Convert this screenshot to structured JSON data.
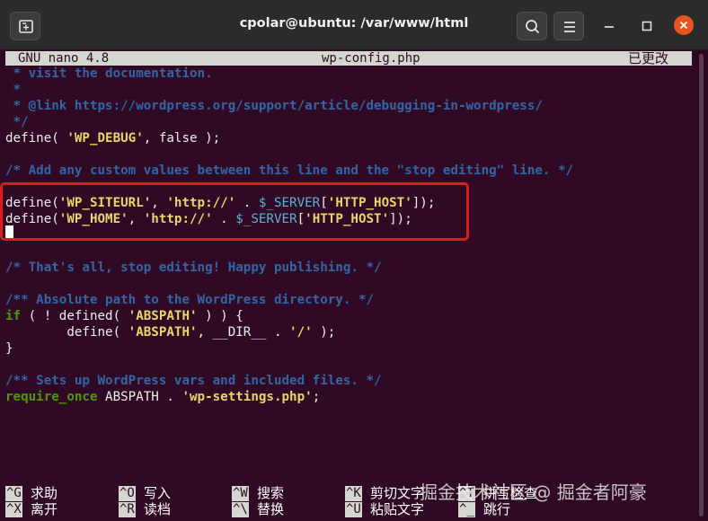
{
  "window": {
    "title": "cpolar@ubuntu: /var/www/html"
  },
  "nano": {
    "version": "GNU nano 4.8",
    "filename": "wp-config.php",
    "status": "已更改"
  },
  "code": [
    [
      {
        "t": " * visit the documentation.",
        "c": "comment"
      }
    ],
    [
      {
        "t": " *",
        "c": "comment"
      }
    ],
    [
      {
        "t": " * @link https://wordpress.org/support/article/debugging-in-wordpress/",
        "c": "comment"
      }
    ],
    [
      {
        "t": " */",
        "c": "comment"
      }
    ],
    [
      {
        "t": "define( ",
        "c": "fn"
      },
      {
        "t": "'WP_DEBUG'",
        "c": "str"
      },
      {
        "t": ", false );",
        "c": "fn"
      }
    ],
    [],
    [
      {
        "t": "/* Add any custom values between this line and the \"stop editing\" line. */",
        "c": "comment"
      }
    ],
    [],
    [
      {
        "t": "define(",
        "c": "fn"
      },
      {
        "t": "'WP_SITEURL'",
        "c": "str"
      },
      {
        "t": ", ",
        "c": "fn"
      },
      {
        "t": "'http://'",
        "c": "str"
      },
      {
        "t": " . ",
        "c": "fn"
      },
      {
        "t": "$_SERVER",
        "c": "var"
      },
      {
        "t": "[",
        "c": "fn"
      },
      {
        "t": "'HTTP_HOST'",
        "c": "str"
      },
      {
        "t": "]);",
        "c": "fn"
      }
    ],
    [
      {
        "t": "define(",
        "c": "fn"
      },
      {
        "t": "'WP_HOME'",
        "c": "str"
      },
      {
        "t": ", ",
        "c": "fn"
      },
      {
        "t": "'http://'",
        "c": "str"
      },
      {
        "t": " . ",
        "c": "fn"
      },
      {
        "t": "$_SERVER",
        "c": "var"
      },
      {
        "t": "[",
        "c": "fn"
      },
      {
        "t": "'HTTP_HOST'",
        "c": "str"
      },
      {
        "t": "]);",
        "c": "fn"
      }
    ],
    [],
    [],
    [
      {
        "t": "/* That's all, stop editing! Happy publishing. */",
        "c": "comment"
      }
    ],
    [],
    [
      {
        "t": "/** Absolute path to the WordPress directory. */",
        "c": "comment"
      }
    ],
    [
      {
        "t": "if",
        "c": "kw"
      },
      {
        "t": " ( ! defined( ",
        "c": "fn"
      },
      {
        "t": "'ABSPATH'",
        "c": "str"
      },
      {
        "t": " ) ) {",
        "c": "fn"
      }
    ],
    [
      {
        "t": "        define( ",
        "c": "fn"
      },
      {
        "t": "'ABSPATH'",
        "c": "str"
      },
      {
        "t": ", __DIR__ . ",
        "c": "fn"
      },
      {
        "t": "'/'",
        "c": "str"
      },
      {
        "t": " );",
        "c": "fn"
      }
    ],
    [
      {
        "t": "}",
        "c": "fn"
      }
    ],
    [],
    [
      {
        "t": "/** Sets up WordPress vars and included files. */",
        "c": "comment"
      }
    ],
    [
      {
        "t": "require_once",
        "c": "kw"
      },
      {
        "t": " ABSPATH . ",
        "c": "fn"
      },
      {
        "t": "'wp-settings.php'",
        "c": "str"
      },
      {
        "t": ";",
        "c": "fn"
      }
    ]
  ],
  "shortcuts": [
    {
      "key": "^G",
      "label": "求助"
    },
    {
      "key": "^X",
      "label": "离开"
    },
    {
      "key": "^O",
      "label": "写入"
    },
    {
      "key": "^R",
      "label": "读档"
    },
    {
      "key": "^W",
      "label": "搜索"
    },
    {
      "key": "^\\",
      "label": "替换"
    },
    {
      "key": "^K",
      "label": "剪切文字"
    },
    {
      "key": "^U",
      "label": "粘贴文字"
    },
    {
      "key": "^T",
      "label": "拼写检查"
    },
    {
      "key": "^_",
      "label": "跳行"
    }
  ],
  "watermark": "掘金技术社区 @ 掘金者阿豪",
  "colors": {
    "terminal_bg": "#300a24",
    "comment": "#3465a4",
    "string": "#e9d66b",
    "variable": "#5eb1d6",
    "keyword": "#4e9a06",
    "highlight_box": "#e0191c"
  },
  "icons": [
    "new-tab-icon",
    "search-icon",
    "hamburger-menu-icon",
    "minimize-icon",
    "maximize-icon",
    "close-icon"
  ]
}
